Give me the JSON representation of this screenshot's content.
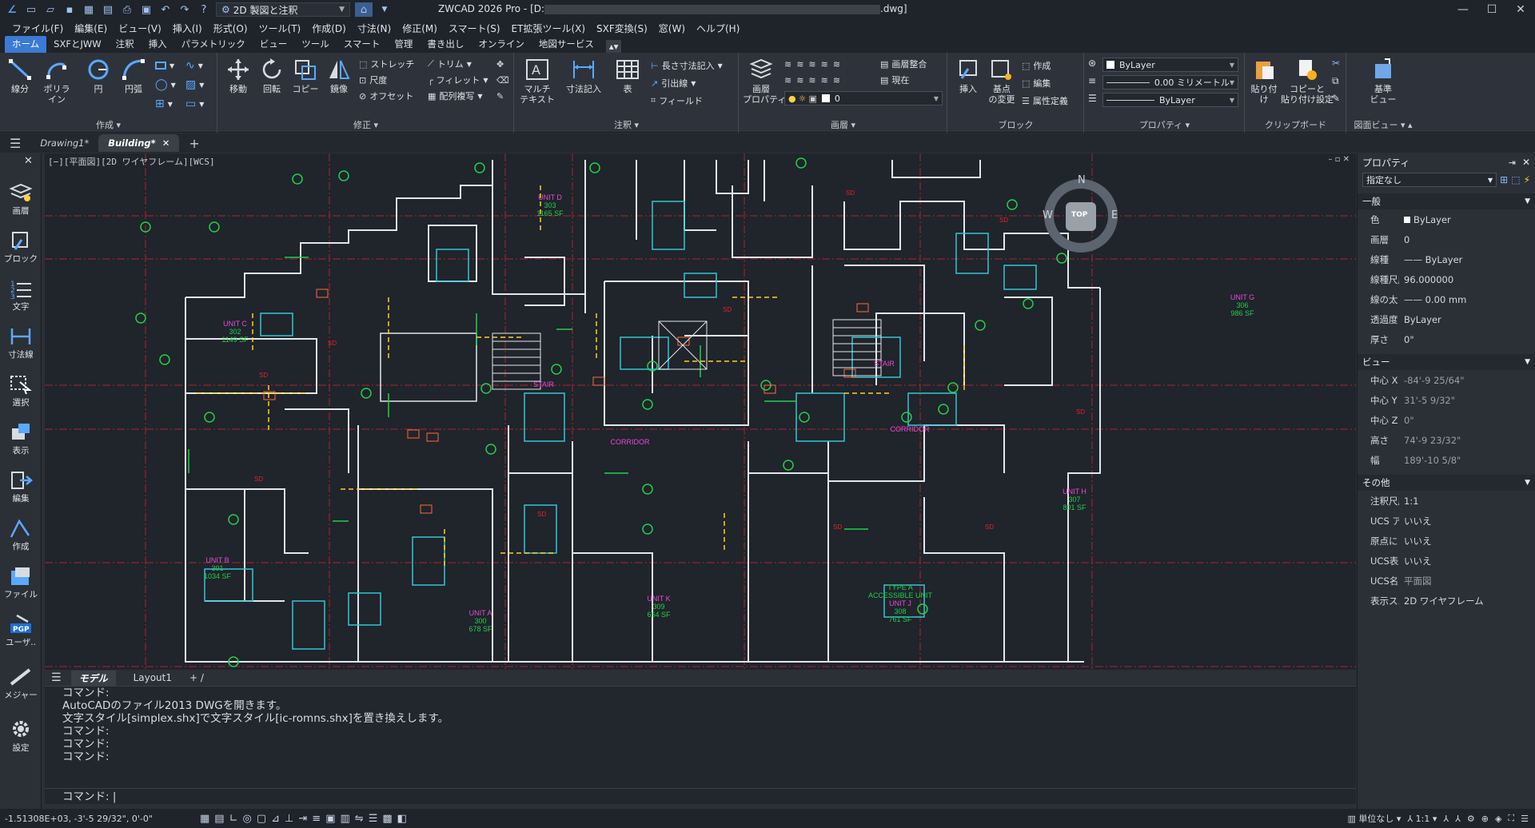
{
  "window": {
    "title_prefix": "ZWCAD 2026 Pro - [D:",
    "title_suffix": ".dwg]",
    "minimize": "—",
    "maximize": "☐",
    "close": "✕"
  },
  "workspace": {
    "label": "2D 製図と注釈"
  },
  "menus": [
    "ファイル(F)",
    "編集(E)",
    "ビュー(V)",
    "挿入(I)",
    "形式(O)",
    "ツール(T)",
    "作成(D)",
    "寸法(N)",
    "修正(M)",
    "スマート(S)",
    "ET拡張ツール(X)",
    "SXF変換(S)",
    "窓(W)",
    "ヘルプ(H)"
  ],
  "ribbon_tabs": [
    "ホーム",
    "SXFとJWW",
    "注釈",
    "挿入",
    "パラメトリック",
    "ビュー",
    "ツール",
    "スマート",
    "管理",
    "書き出し",
    "オンライン",
    "地図サービス"
  ],
  "ribbon": {
    "draw": {
      "title": "作成",
      "line": "線分",
      "polyline": "ポリライン",
      "circle": "円",
      "arc": "円弧"
    },
    "modify": {
      "title": "修正",
      "move": "移動",
      "rotate": "回転",
      "copy": "コピー",
      "mirror": "鏡像",
      "stretch": "ストレッチ",
      "scale": "尺度",
      "offset": "オフセット",
      "trim": "トリム",
      "fillet": "フィレット",
      "array": "配列複写"
    },
    "annotation": {
      "title": "注釈",
      "mtext": "マルチ\nテキスト",
      "dim": "寸法記入",
      "table": "表",
      "lineardim": "長さ寸法記入",
      "leader": "引出線",
      "field": "フィールド"
    },
    "layers": {
      "title": "画層",
      "props": "画層\nプロパティ",
      "match": "画層整合",
      "current": "現在",
      "layer_value": "0"
    },
    "block": {
      "title": "ブロック",
      "insert": "挿入",
      "basepoint": "基点\nの変更",
      "create": "作成",
      "edit": "編集",
      "attdef": "属性定義"
    },
    "properties": {
      "title": "プロパティ",
      "color": "ByLayer",
      "lineweight": "0.00 ミリメートル",
      "linetype": "ByLayer"
    },
    "clipboard": {
      "title": "クリップボード",
      "paste": "貼り付け",
      "copypaste": "コピーと\n貼り付け設定"
    },
    "view": {
      "title": "図面ビュー",
      "base": "基準\nビュー"
    }
  },
  "file_tabs": [
    {
      "label": "Drawing1*"
    },
    {
      "label": "Building*"
    }
  ],
  "left_tools": [
    "画層",
    "ブロック",
    "文字",
    "寸法線",
    "選択",
    "表示",
    "編集",
    "作成",
    "ファイル",
    "ユーザ..",
    "メジャー",
    "設定"
  ],
  "viewport_label": "[−][平面図][2D ワイヤフレーム][WCS]",
  "viewcube": {
    "top": "TOP",
    "n": "N",
    "s": "S",
    "e": "E",
    "w": "W"
  },
  "drawing_labels": [
    {
      "t": "UNIT D",
      "s": "303",
      "a": "1165 SF"
    },
    {
      "t": "UNIT C",
      "s": "302",
      "a": "1149 SF"
    },
    {
      "t": "UNIT G",
      "s": "306",
      "a": "986 SF"
    },
    {
      "t": "UNIT B",
      "s": "301",
      "a": "1034 SF"
    },
    {
      "t": "UNIT A",
      "s": "300",
      "a": "678 SF"
    },
    {
      "t": "UNIT K",
      "s": "309",
      "a": "664 SF"
    },
    {
      "t": "UNIT J",
      "s": "308",
      "a": "761 SF"
    },
    {
      "t": "UNIT H",
      "s": "307",
      "a": "801 SF"
    }
  ],
  "drawing_misc": {
    "stair": "STAIR",
    "corridor": "CORRIDOR",
    "accessible": "TYPE A\nACCESSIBLE UNIT",
    "sd": "SD"
  },
  "model_tabs": [
    "モデル",
    "Layout1"
  ],
  "command_lines": [
    "コマンド:",
    "AutoCADのファイル2013 DWGを開きます。",
    "文字スタイル[simplex.shx]で文字スタイル[ic-romns.shx]を置き換えします。",
    "コマンド:",
    "コマンド:",
    "コマンド:"
  ],
  "command_prompt": "コマンド:",
  "properties_panel": {
    "title": "プロパティ",
    "selection": "指定なし",
    "sections": [
      {
        "name": "一般",
        "rows": [
          {
            "k": "色",
            "v": "ByLayer"
          },
          {
            "k": "画層",
            "v": "0"
          },
          {
            "k": "線種",
            "v": "—— ByLayer"
          },
          {
            "k": "線種尺度",
            "v": "96.000000"
          },
          {
            "k": "線の太さ",
            "v": "—— 0.00 mm"
          },
          {
            "k": "透過度",
            "v": "ByLayer"
          },
          {
            "k": "厚さ",
            "v": "0\""
          }
        ]
      },
      {
        "name": "ビュー",
        "rows": [
          {
            "k": "中心 X",
            "v": "-84'-9 25/64\""
          },
          {
            "k": "中心 Y",
            "v": "31'-5 9/32\""
          },
          {
            "k": "中心 Z",
            "v": "0\""
          },
          {
            "k": "高さ",
            "v": "74'-9 23/32\""
          },
          {
            "k": "幅",
            "v": "189'-10 5/8\""
          }
        ]
      },
      {
        "name": "その他",
        "rows": [
          {
            "k": "注釈尺度",
            "v": "1:1"
          },
          {
            "k": "UCS ア...",
            "v": "いいえ"
          },
          {
            "k": "原点に ...",
            "v": "いいえ"
          },
          {
            "k": "UCS表示",
            "v": "いいえ"
          },
          {
            "k": "UCS名",
            "v": "平面図"
          },
          {
            "k": "表示ス...",
            "v": "2D ワイヤフレーム"
          }
        ]
      }
    ]
  },
  "status": {
    "coords": "-1.51308E+03, -3'-5 29/32\", 0'-0\"",
    "units": "単位なし",
    "scale": "1:1"
  }
}
